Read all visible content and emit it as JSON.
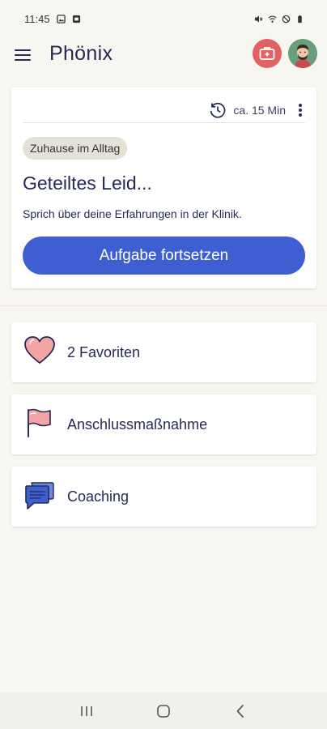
{
  "status_bar": {
    "time": "11:45",
    "left_icons": [
      "image-icon",
      "notification-icon"
    ],
    "right_icons": [
      "mute-icon",
      "wifi-icon",
      "do-not-disturb-icon",
      "battery-icon"
    ]
  },
  "app_bar": {
    "title": "Phönix",
    "menu_icon": "hamburger-menu-icon",
    "toolkit_icon": "first-aid-kit-icon",
    "avatar_icon": "user-avatar-icon"
  },
  "task_card": {
    "duration": "ca. 15 Min",
    "duration_icon": "clock-history-icon",
    "more_icon": "more-vertical-icon",
    "tag": "Zuhause im Alltag",
    "title": "Geteiltes Leid...",
    "description": "Sprich über deine Erfahrungen in der Klinik.",
    "button_label": "Aufgabe fortsetzen"
  },
  "list": [
    {
      "label": "2 Favoriten",
      "icon": "heart-icon"
    },
    {
      "label": "Anschlussmaßnahme",
      "icon": "flag-icon"
    },
    {
      "label": "Coaching",
      "icon": "chat-bubble-icon"
    }
  ],
  "nav_bar": {
    "recents_icon": "recent-apps-icon",
    "home_icon": "home-icon",
    "back_icon": "back-icon"
  },
  "colors": {
    "background": "#f8f6f1",
    "primary": "#3e5fd2",
    "text": "#262a55",
    "toolkit": "#e26161",
    "avatar": "#6a9d7c",
    "tag": "#e4e1d7",
    "icon_pink": "#f2a3a3",
    "icon_blue": "#3e5fd2"
  }
}
